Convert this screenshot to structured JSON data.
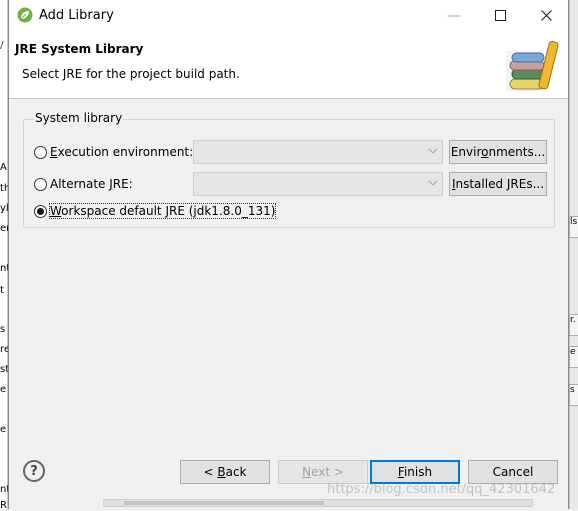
{
  "window": {
    "title": "Add Library"
  },
  "header": {
    "title": "JRE System Library",
    "description": "Select JRE for the project build path."
  },
  "group": {
    "label": "System library"
  },
  "options": [
    {
      "label_pre": "",
      "mnemonic": "E",
      "label_post": "xecution environment:",
      "checked": false
    },
    {
      "label_pre": "Alternate ",
      "mnemonic": "J",
      "label_post": "RE:",
      "checked": false
    },
    {
      "label_pre": "",
      "mnemonic": "W",
      "label_post": "orkspace default JRE (jdk1.8.0_131)",
      "checked": true
    }
  ],
  "side_buttons": {
    "environments": {
      "pre": "Envir",
      "mn": "o",
      "post": "nments..."
    },
    "installed": {
      "pre": "",
      "mn": "I",
      "post": "nstalled JREs..."
    }
  },
  "footer": {
    "back": {
      "pre": "< ",
      "mn": "B",
      "post": "ack"
    },
    "next": {
      "pre": "",
      "mn": "N",
      "post": "ext >"
    },
    "finish": {
      "pre": "",
      "mn": "F",
      "post": "inish"
    },
    "cancel": "Cancel",
    "watermark": "https://blog.csdn.net/qq_42301642"
  },
  "icons": [
    "spring-leaf-icon",
    "minimize-icon",
    "maximize-icon",
    "close-icon",
    "library-books-icon",
    "chevron-down-icon",
    "help-icon"
  ],
  "colors": {
    "accent": "#0078d7",
    "spring_green": "#6db33f"
  },
  "background": {
    "left_chars": [
      "/",
      "A",
      "th",
      "yl",
      "er",
      "nt",
      "t",
      "s",
      "re",
      "st",
      "e",
      "e",
      "nt",
      "RE"
    ],
    "right_chars": [
      "ls",
      "r.",
      "e",
      "s"
    ]
  }
}
